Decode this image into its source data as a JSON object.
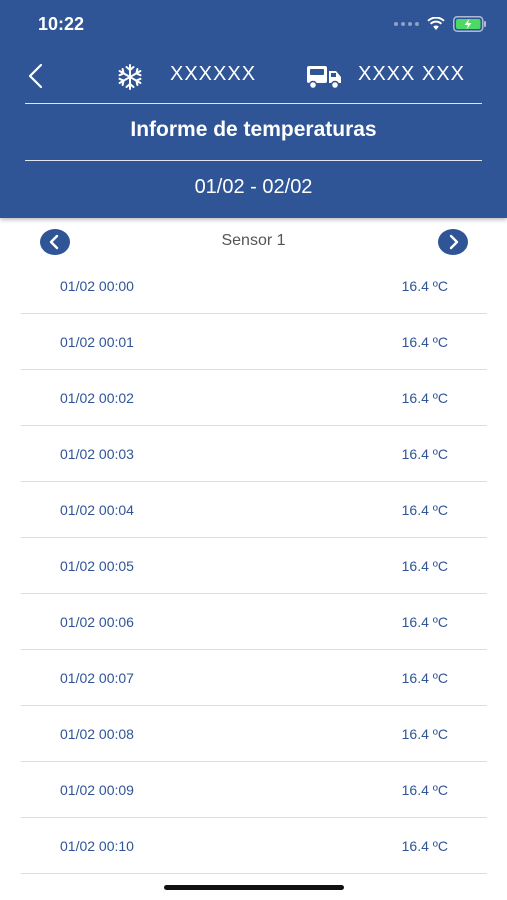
{
  "status_bar": {
    "time": "10:22"
  },
  "header": {
    "unit_id": "XXXXXX",
    "plate": "XXXX XXX",
    "title": "Informe de temperaturas",
    "date_range": "01/02 - 02/02",
    "icons": [
      "chevron-left-icon",
      "snowflake-icon",
      "truck-icon"
    ],
    "background_color": "#2f5596"
  },
  "sensor": {
    "label": "Sensor 1",
    "prev_icon": "chevron-left-circle-icon",
    "next_icon": "chevron-right-circle-icon"
  },
  "readings": [
    {
      "time": "01/02 00:00",
      "value": "16.4 ºC"
    },
    {
      "time": "01/02 00:01",
      "value": "16.4 ºC"
    },
    {
      "time": "01/02 00:02",
      "value": "16.4 ºC"
    },
    {
      "time": "01/02 00:03",
      "value": "16.4 ºC"
    },
    {
      "time": "01/02 00:04",
      "value": "16.4 ºC"
    },
    {
      "time": "01/02 00:05",
      "value": "16.4 ºC"
    },
    {
      "time": "01/02 00:06",
      "value": "16.4 ºC"
    },
    {
      "time": "01/02 00:07",
      "value": "16.4 ºC"
    },
    {
      "time": "01/02 00:08",
      "value": "16.4 ºC"
    },
    {
      "time": "01/02 00:09",
      "value": "16.4 ºC"
    },
    {
      "time": "01/02 00:10",
      "value": "16.4 ºC"
    }
  ]
}
